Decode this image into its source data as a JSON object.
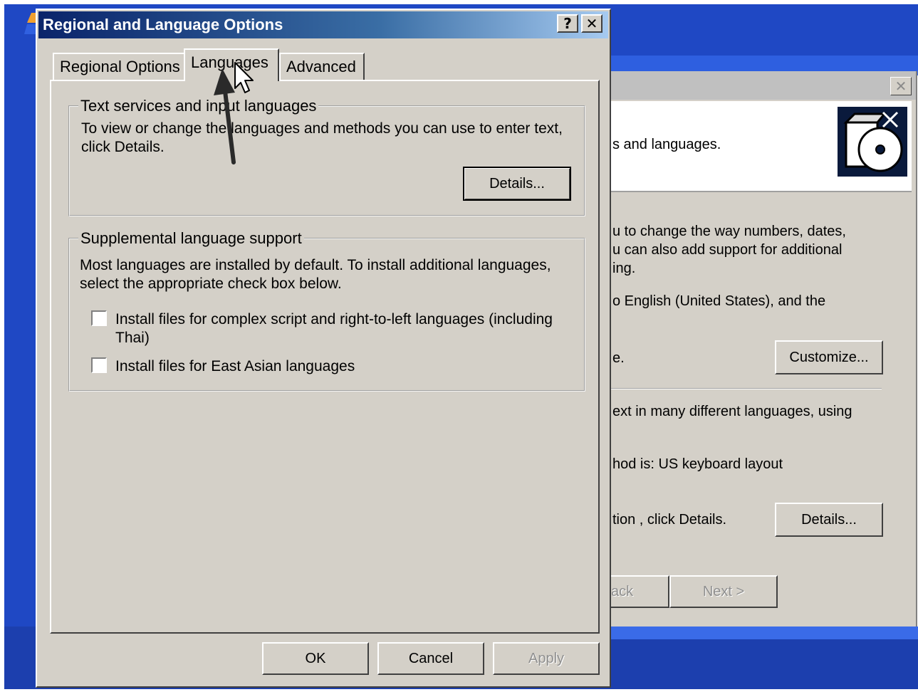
{
  "dialog": {
    "title": "Regional and Language Options",
    "help_button": "?",
    "close_button": "✕",
    "tabs": [
      {
        "label": "Regional Options"
      },
      {
        "label": "Languages"
      },
      {
        "label": "Advanced"
      }
    ],
    "active_tab": "Languages",
    "text_services_group": {
      "label": "Text services and input languages",
      "description": "To view or change the languages and methods you can use to enter text, click Details.",
      "details_button": "Details..."
    },
    "supplemental_group": {
      "label": "Supplemental language support",
      "description": "Most languages are installed by default. To install additional languages, select the appropriate check box below.",
      "checkboxes": [
        {
          "label": "Install files for complex script and right-to-left languages (including Thai)",
          "checked": false
        },
        {
          "label": "Install files for East Asian languages",
          "checked": false
        }
      ]
    },
    "buttons": {
      "ok": "OK",
      "cancel": "Cancel",
      "apply": "Apply"
    }
  },
  "background_window": {
    "close_button": "✕",
    "header_text": "s and languages.",
    "para1_line1": "u to change the way numbers, dates,",
    "para1_line2": "u can also add support for additional",
    "para1_line3": "ing.",
    "para2": "o English (United States), and the",
    "para3": "e.",
    "customize_button": "Customize...",
    "para4": "ext in many different languages, using",
    "para5": "hod is: US keyboard layout",
    "para6": "tion , click Details.",
    "details_button": "Details...",
    "back_button": "ack",
    "next_button": "Next >"
  }
}
